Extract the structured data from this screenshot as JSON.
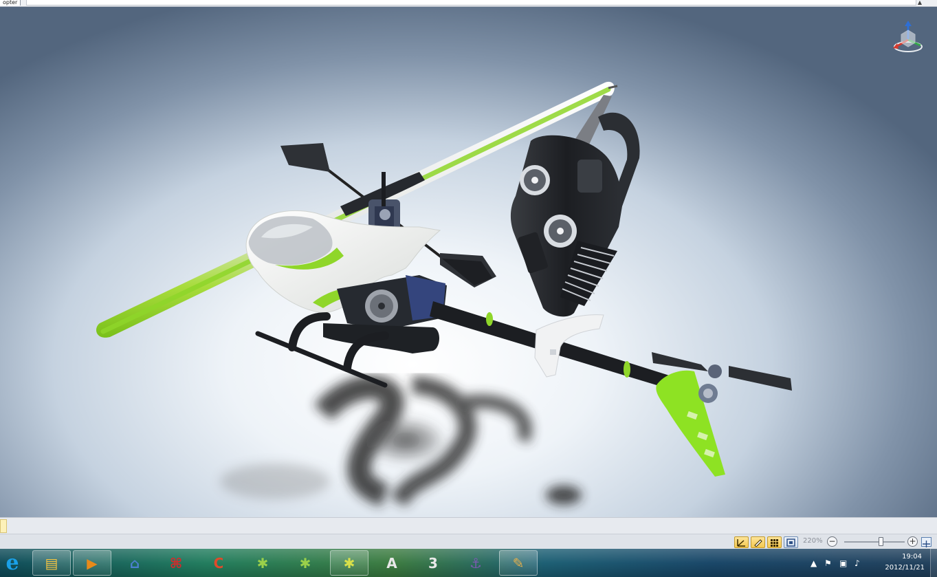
{
  "window": {
    "title_fragment": "opter"
  },
  "colors": {
    "accent_green": "#8fd62a",
    "body_white": "#f2f3f1",
    "frame_dark": "#262a30",
    "frame_blue": "#3a4e8c"
  },
  "viewport": {
    "gizmo_icon": "view-cube-icon"
  },
  "toolbar": {
    "view_buttons": [
      "orientation-icon",
      "ruler-icon",
      "grid-icon",
      "frame-icon"
    ],
    "zoom_label": "220%",
    "zoom_minus": "−",
    "zoom_plus": "+",
    "zoom_level": 0.6
  },
  "taskbar": {
    "apps": [
      {
        "name": "internet-explorer",
        "glyph": "e"
      },
      {
        "name": "file-explorer",
        "glyph": "▤"
      },
      {
        "name": "media-player",
        "glyph": "▶"
      },
      {
        "name": "network-tool",
        "glyph": "⌂"
      },
      {
        "name": "pdf-reader",
        "glyph": "⌘"
      },
      {
        "name": "ccleaner",
        "glyph": "C"
      },
      {
        "name": "molecule-app-1",
        "glyph": "✱"
      },
      {
        "name": "molecule-app-2",
        "glyph": "✱"
      },
      {
        "name": "molecule-app-3",
        "glyph": "✱"
      },
      {
        "name": "cad-app",
        "glyph": "A"
      },
      {
        "name": "3ds-app",
        "glyph": "3"
      },
      {
        "name": "ship-app",
        "glyph": "⚓"
      },
      {
        "name": "paint-app",
        "glyph": "✎"
      }
    ],
    "clock_time": "19:04",
    "clock_date": "2012/11/21"
  }
}
